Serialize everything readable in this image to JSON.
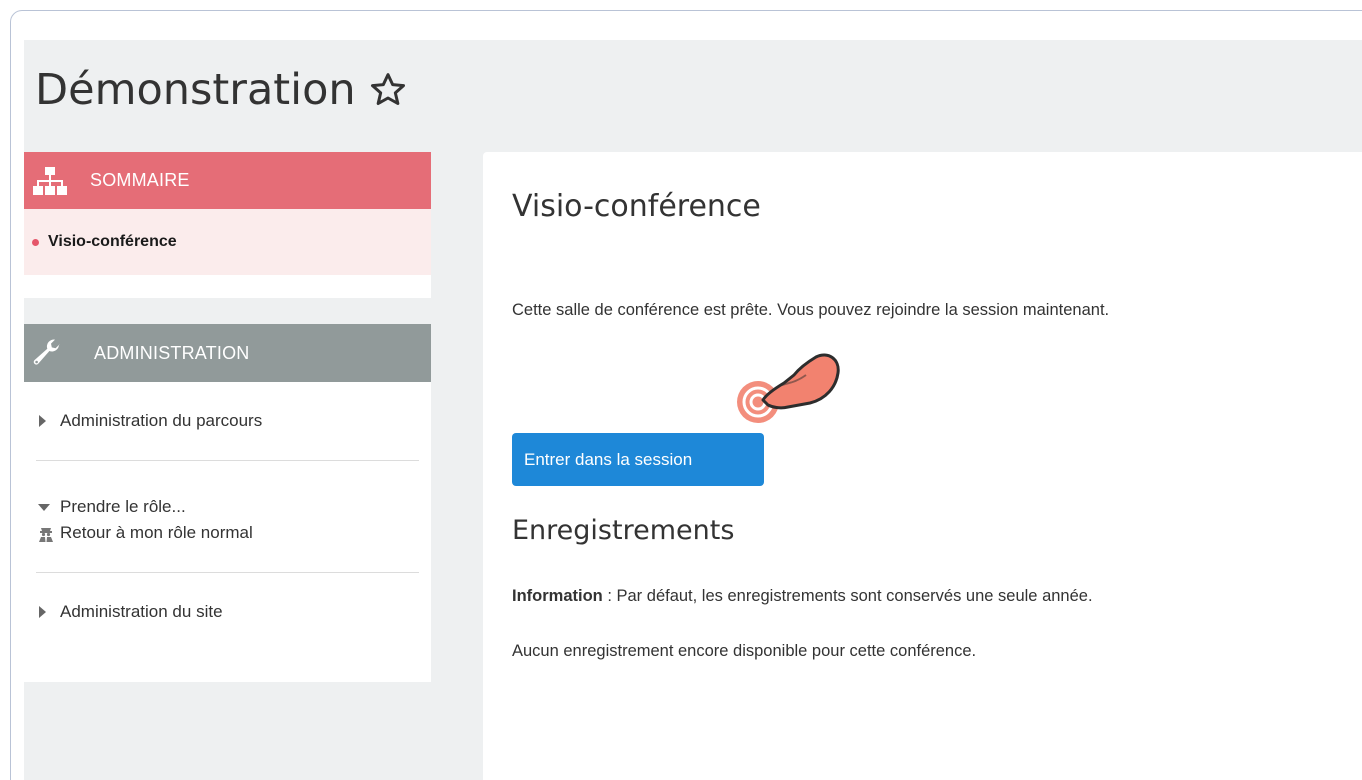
{
  "course": {
    "title": "Démonstration"
  },
  "sidebar": {
    "sommaire": {
      "header_label": "SOMMAIRE",
      "header_icon": "sitemap-icon",
      "color": "#e56d77",
      "items": [
        {
          "label": "Visio-conférence",
          "active": true
        }
      ]
    },
    "administration": {
      "header_label": "ADMINISTRATION",
      "header_icon": "wrench-icon",
      "color": "#919a9a",
      "items": [
        {
          "label": "Administration du parcours",
          "expanded": false
        },
        {
          "label": "Prendre le rôle...",
          "expanded": true,
          "children": [
            {
              "label": "Retour à mon rôle normal",
              "icon": "user-secret-icon"
            }
          ]
        },
        {
          "label": "Administration du site",
          "expanded": false
        }
      ]
    }
  },
  "main": {
    "title": "Visio-conférence",
    "ready_message": "Cette salle de conférence est prête. Vous pouvez rejoindre la session maintenant.",
    "enter_button": "Entrer dans la session",
    "enter_button_color": "#1e88d8",
    "recordings_title": "Enregistrements",
    "info_label": "Information",
    "info_text": " : Par défaut, les enregistrements sont conservés une seule année.",
    "no_recordings": "Aucun enregistrement encore disponible pour cette conférence."
  }
}
